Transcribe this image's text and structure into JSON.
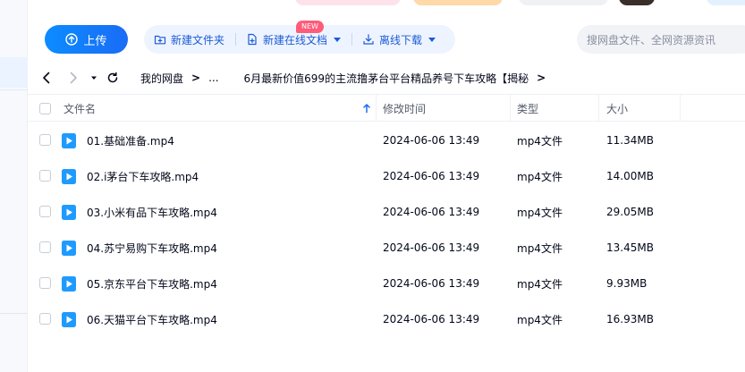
{
  "toolbar": {
    "upload_label": "上传",
    "new_folder_label": "新建文件夹",
    "new_online_doc_label": "新建在线文档",
    "new_badge": "NEW",
    "offline_download_label": "离线下载",
    "search_placeholder": "搜网盘文件、全网资源资讯"
  },
  "breadcrumb": {
    "root": "我的网盘",
    "ellipsis": "...",
    "current": "6月最新价值699的主流撸茅台平台精品养号下车攻略【揭秘",
    "separator": ">"
  },
  "table": {
    "columns": {
      "name": "文件名",
      "modified": "修改时间",
      "type": "类型",
      "size": "大小"
    },
    "rows": [
      {
        "name": "01.基础准备.mp4",
        "modified": "2024-06-06 13:49",
        "type": "mp4文件",
        "size": "11.34MB"
      },
      {
        "name": "02.i茅台下车攻略.mp4",
        "modified": "2024-06-06 13:49",
        "type": "mp4文件",
        "size": "14.00MB"
      },
      {
        "name": "03.小米有品下车攻略.mp4",
        "modified": "2024-06-06 13:49",
        "type": "mp4文件",
        "size": "29.05MB"
      },
      {
        "name": "04.苏宁易购下车攻略.mp4",
        "modified": "2024-06-06 13:49",
        "type": "mp4文件",
        "size": "13.45MB"
      },
      {
        "name": "05.京东平台下车攻略.mp4",
        "modified": "2024-06-06 13:49",
        "type": "mp4文件",
        "size": "9.93MB"
      },
      {
        "name": "06.天猫平台下车攻略.mp4",
        "modified": "2024-06-06 13:49",
        "type": "mp4文件",
        "size": "16.93MB"
      }
    ]
  },
  "icons": {
    "file": "video-file-icon",
    "back": "arrow-left-icon",
    "forward": "arrow-right-icon",
    "history": "caret-down-icon",
    "refresh": "refresh-icon"
  },
  "colors": {
    "accent": "#1a6cf5",
    "file_icon": "#1f9bff",
    "tool_bg": "#eef4ff",
    "badge": "#ff5c7a"
  }
}
